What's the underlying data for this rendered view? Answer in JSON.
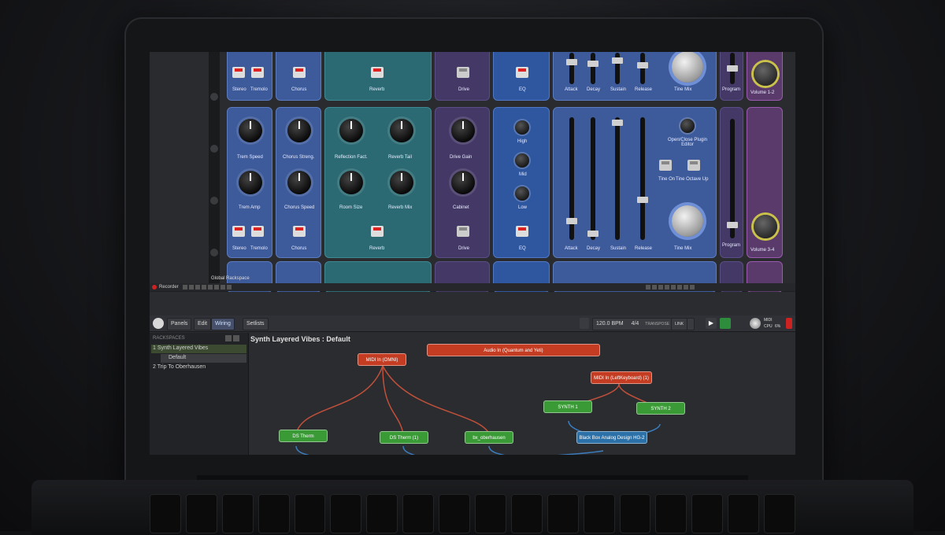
{
  "rack": {
    "units": {
      "trem": {
        "stereo": "Stereo",
        "tremolo": "Tremolo",
        "trem_speed": "Trem Speed",
        "trem_amp": "Trem Amp"
      },
      "chorus": {
        "chorus": "Chorus",
        "chorus_streng": "Chorus Streng.",
        "chorus_speed": "Chorus Speed"
      },
      "reverb": {
        "reverb": "Reverb",
        "reflection_fact": "Reflection Fact.",
        "reverb_tail": "Reverb Tail",
        "room_size": "Room Size",
        "reverb_mix": "Reverb Mix"
      },
      "drive": {
        "drive": "Drive",
        "drive_gain": "Drive Gain",
        "cabinet": "Cabinet"
      },
      "eq": {
        "eq": "EQ",
        "high": "High",
        "mid": "Mid",
        "low": "Low"
      },
      "adsr": {
        "attack": "Attack",
        "decay": "Decay",
        "decay_top": "Decay",
        "sustain": "Sustain",
        "release": "Release"
      },
      "synth": {
        "plugin_editor": "Open/Close Plugin Editor",
        "tine_on": "Tine On",
        "tine_octave_up": "Tine Octave Up",
        "tine_mix": "Tine Mix"
      },
      "program": "Program",
      "volume_1_2": "Volume 1-2",
      "volume_3_4": "Volume 3-4"
    },
    "global_rackspace": "Global Rackspace",
    "recorder": "Recorder"
  },
  "toolbar": {
    "panels": "Panels",
    "edit": "Edit",
    "wiring": "Wiring",
    "setlists": "Setlists",
    "bpm": "120.0 BPM",
    "time_sig": "4/4",
    "transpose_label": "TRANSPOSE",
    "transpose_value": "0",
    "link": "LINK",
    "midi": "MIDI",
    "cpu": "CPU",
    "cpu_value": "6%"
  },
  "sidebar": {
    "header": "RACKSPACES",
    "items": [
      {
        "label": "1  Synth Layered Vibes"
      },
      {
        "label": "Default"
      },
      {
        "label": "2  Trip To Oberhausen"
      }
    ]
  },
  "wiring": {
    "title": "Synth Layered Vibes : Default",
    "nodes": {
      "midi_in_omni": "MIDI In (OMNI)",
      "audio_in": "Audio In (Quantum and Yeti)",
      "midi_in_left": "MIDI In (LeftKeyboard) (1)",
      "synth_1": "SYNTH 1",
      "synth_2": "SYNTH 2",
      "black_box": "Black Box Analog Design HG-2",
      "ds_therm": "DS Therm",
      "ds_therm_1": "DS Therm (1)",
      "bx_oberhausen": "bx_oberhausen"
    }
  },
  "colors": {
    "rack_blue": "#3d5a9b",
    "teal": "#2b6a73",
    "purple": "#443866",
    "node_red": "#c43d23",
    "node_green": "#3a9a36",
    "node_blue": "#2b71a8"
  }
}
